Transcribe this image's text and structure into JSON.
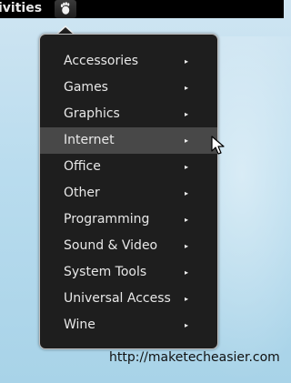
{
  "top_bar": {
    "activities_label": "ivities",
    "foot_icon": "gnome-foot-icon"
  },
  "menu": {
    "items": [
      {
        "label": "Accessories",
        "arrow": "▸"
      },
      {
        "label": "Games",
        "arrow": "▸"
      },
      {
        "label": "Graphics",
        "arrow": "▸"
      },
      {
        "label": "Internet",
        "arrow": "▸"
      },
      {
        "label": "Office",
        "arrow": "▸"
      },
      {
        "label": "Other",
        "arrow": "▸"
      },
      {
        "label": "Programming",
        "arrow": "▸"
      },
      {
        "label": "Sound & Video",
        "arrow": "▸"
      },
      {
        "label": "System Tools",
        "arrow": "▸"
      },
      {
        "label": "Universal Access",
        "arrow": "▸"
      },
      {
        "label": "Wine",
        "arrow": "▸"
      }
    ],
    "highlighted_index": 3
  },
  "watermark": "http://maketecheasier.com",
  "colors": {
    "top_bar": "#000000",
    "menu_background": "#1e1e1e",
    "menu_hover": "#484848",
    "menu_text": "#e8e8e8",
    "wallpaper": "#b9dcee"
  },
  "icons": {
    "cursor": "mouse-pointer-icon",
    "foot": "gnome-foot-icon",
    "submenu": "chevron-right-icon"
  }
}
